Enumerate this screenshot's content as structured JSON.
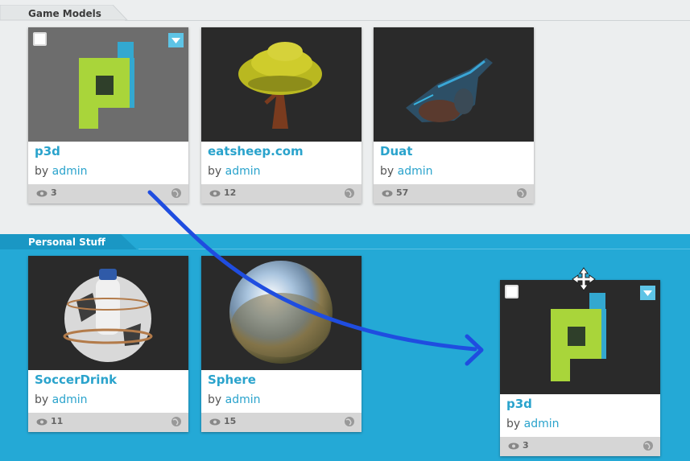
{
  "sections": {
    "game_models": {
      "label": "Game Models"
    },
    "personal_stuff": {
      "label": "Personal Stuff"
    }
  },
  "colors": {
    "accent": "#2aa3cc",
    "section_blue": "#24a9d6",
    "drag_arrow": "#1f4de0"
  },
  "game_models": [
    {
      "title": "p3d",
      "by": "by",
      "author": "admin",
      "views": "3",
      "thumb_icon": "p3d-model-thumbnail"
    },
    {
      "title": "eatsheep.com",
      "by": "by",
      "author": "admin",
      "views": "12",
      "thumb_icon": "tree-model-thumbnail"
    },
    {
      "title": "Duat",
      "by": "by",
      "author": "admin",
      "views": "57",
      "thumb_icon": "vehicle-model-thumbnail"
    }
  ],
  "personal_stuff": [
    {
      "title": "SoccerDrink",
      "by": "by",
      "author": "admin",
      "views": "11",
      "thumb_icon": "soccer-drink-thumbnail"
    },
    {
      "title": "Sphere",
      "by": "by",
      "author": "admin",
      "views": "15",
      "thumb_icon": "sphere-thumbnail"
    }
  ],
  "dragged_card": {
    "title": "p3d",
    "by": "by",
    "author": "admin",
    "views": "3",
    "thumb_icon": "p3d-model-thumbnail"
  },
  "drag_cursor_icon": "move-cursor-icon"
}
